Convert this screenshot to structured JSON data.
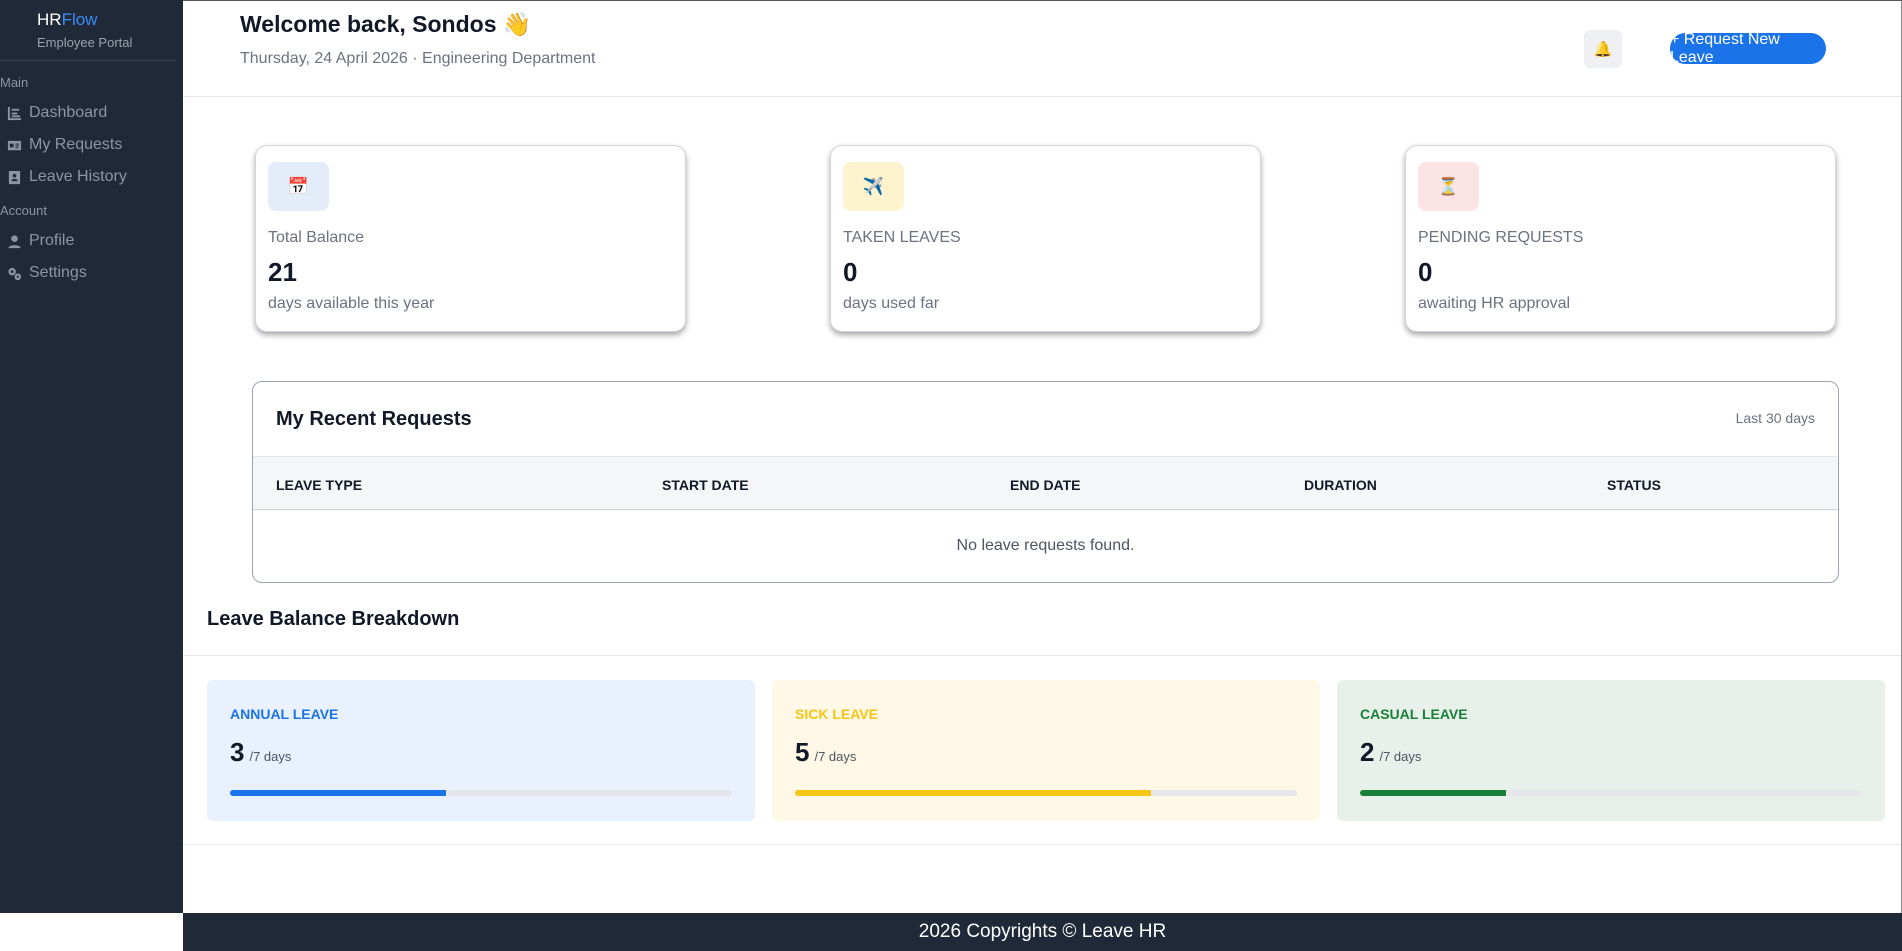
{
  "sidebar": {
    "brand_hr": "HR",
    "brand_flow": "Flow",
    "brand_sub": "Employee Portal",
    "section_main": "Main",
    "section_account": "Account",
    "items": [
      {
        "label": "Dashboard",
        "icon": "chart-icon"
      },
      {
        "label": "My Requests",
        "icon": "id-card-icon"
      },
      {
        "label": "Leave History",
        "icon": "address-book-icon"
      },
      {
        "label": "Profile",
        "icon": "user-icon"
      },
      {
        "label": "Settings",
        "icon": "gears-icon"
      }
    ]
  },
  "header": {
    "welcome": "Welcome back, Sondos 👋",
    "subline": "Thursday, 24 April 2026 · Engineering Department",
    "bell_icon": "🔔",
    "new_leave_label": "+ Request New Leave"
  },
  "stats": [
    {
      "icon": "📅",
      "label": "Total Balance",
      "value": "21",
      "desc": "days available this year",
      "icon_bg": "#e3ecf8"
    },
    {
      "icon": "✈️",
      "label": "TAKEN LEAVES",
      "value": "0",
      "desc": "days used far",
      "icon_bg": "#fdf3cf"
    },
    {
      "icon": "⏳",
      "label": "PENDING REQUESTS",
      "value": "0",
      "desc": "awaiting HR approval",
      "icon_bg": "#fce4e4"
    }
  ],
  "requests": {
    "title": "My Recent Requests",
    "range": "Last 30 days",
    "columns": [
      "LEAVE TYPE",
      "START DATE",
      "END DATE",
      "DURATION",
      "STATUS"
    ],
    "empty": "No leave requests found."
  },
  "breakdown": {
    "title": "Leave Balance Breakdown",
    "cards": [
      {
        "label": "ANNUAL LEAVE",
        "value": "3",
        "unit": "/7 days",
        "fraction": 0.43,
        "color": "#1a73e8",
        "bg": "#e8f1fd"
      },
      {
        "label": "SICK LEAVE",
        "value": "5",
        "unit": "/7 days",
        "fraction": 0.71,
        "color": "#f5c518",
        "bg": "#fff8e6"
      },
      {
        "label": "CASUAL LEAVE",
        "value": "2",
        "unit": "/7 days",
        "fraction": 0.29,
        "color": "#188038",
        "bg": "#e7f1ea"
      }
    ]
  },
  "footer": {
    "text": "2026 Copyrights © Leave HR"
  }
}
